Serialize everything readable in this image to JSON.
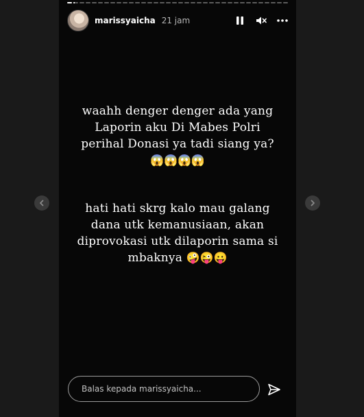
{
  "story": {
    "progress": [
      1.0,
      0.3,
      0,
      0,
      0,
      0,
      0,
      0,
      0,
      0,
      0,
      0,
      0,
      0,
      0,
      0,
      0,
      0,
      0,
      0,
      0,
      0,
      0,
      0,
      0,
      0,
      0,
      0,
      0,
      0,
      0,
      0,
      0,
      0,
      0,
      0
    ],
    "username": "marissyaicha",
    "timestamp": "21 jam",
    "paragraphs": [
      {
        "lines": [
          "waahh denger denger ada yang",
          "Laporin aku Di Mabes Polri",
          "perihal Donasi ya tadi siang ya?"
        ],
        "emoji": "😱😱😱😱"
      },
      {
        "lines": [
          "hati hati skrg kalo mau galang",
          "dana utk kemanusiaan, akan",
          "diprovokasi utk dilaporin sama si",
          "mbaknya"
        ],
        "emoji": "🤪😜😛"
      }
    ],
    "reply": {
      "placeholder": "Balas kepada marissyaicha..."
    }
  },
  "icons": {
    "pause": "pause-icon",
    "mute": "speaker-muted-icon",
    "more": "more-options-icon",
    "prev": "chevron-left-icon",
    "next": "chevron-right-icon",
    "send": "send-icon"
  }
}
